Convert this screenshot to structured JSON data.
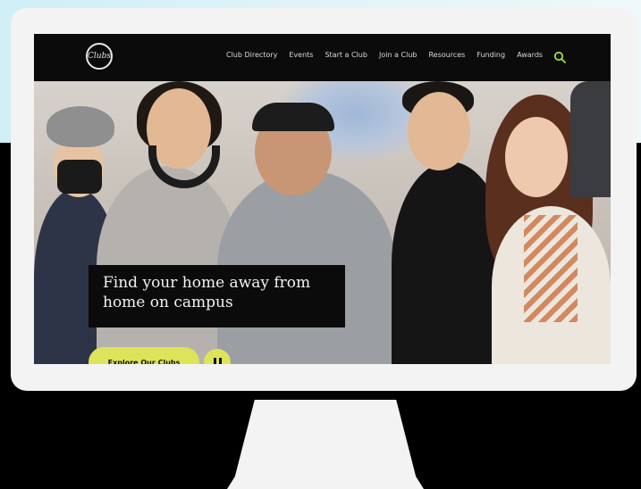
{
  "nav": {
    "logo_text": "Clubs",
    "items": [
      {
        "label": "Club Directory"
      },
      {
        "label": "Events"
      },
      {
        "label": "Start a Club"
      },
      {
        "label": "Join a Club"
      },
      {
        "label": "Resources"
      },
      {
        "label": "Funding"
      },
      {
        "label": "Awards"
      }
    ]
  },
  "hero": {
    "headline_line1": "Find your home away from",
    "headline_line2": "home on campus",
    "cta_label": "Explore Our Clubs"
  },
  "colors": {
    "accent": "#dce55a",
    "nav_bg": "#0b0b0b",
    "search_icon": "#9fe03a"
  }
}
